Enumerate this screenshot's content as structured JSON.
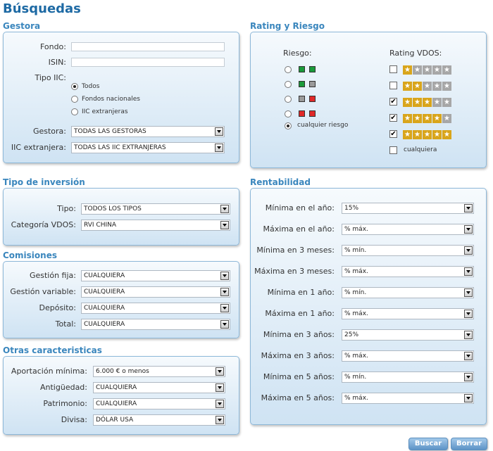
{
  "page": {
    "title": "Búsquedas"
  },
  "gestora": {
    "section_title": "Gestora",
    "fondo_label": "Fondo:",
    "fondo_value": "",
    "isin_label": "ISIN:",
    "isin_value": "",
    "tipo_iic_label": "Tipo IIC:",
    "tipo_iic_options": [
      "Todos",
      "Fondos nacionales",
      "IIC extranjeras"
    ],
    "tipo_iic_selected": "Todos",
    "gestora_label": "Gestora:",
    "gestora_value": "TODAS LAS GESTORAS",
    "iic_ext_label": "IIC extranjera:",
    "iic_ext_value": "TODAS LAS IIC EXTRANJERAS"
  },
  "rating": {
    "section_title": "Rating y Riesgo",
    "riesgo_label": "Riesgo:",
    "rating_label": "Rating VDOS:",
    "riesgo_options": [
      {
        "colors": [
          "#1a9a3a",
          "#1a9a3a"
        ]
      },
      {
        "colors": [
          "#1a9a3a",
          "#9a9a9a"
        ]
      },
      {
        "colors": [
          "#9a9a9a",
          "#e02828"
        ]
      },
      {
        "colors": [
          "#e02828",
          "#e02828"
        ]
      }
    ],
    "riesgo_any_label": "cualquier riesgo",
    "riesgo_selected": "cualquier riesgo",
    "rating_options": [
      {
        "stars": 1,
        "checked": false
      },
      {
        "stars": 2,
        "checked": false
      },
      {
        "stars": 3,
        "checked": true
      },
      {
        "stars": 4,
        "checked": true
      },
      {
        "stars": 5,
        "checked": true
      }
    ],
    "rating_any_label": "cualquiera",
    "rating_any_checked": false,
    "star_on_color": "#d9a51b",
    "star_off_color": "#a7a7a7"
  },
  "tipo_inversion": {
    "section_title": "Tipo de inversión",
    "tipo_label": "Tipo:",
    "tipo_value": "TODOS LOS TIPOS",
    "categoria_label": "Categoría VDOS:",
    "categoria_value": "RVI CHINA"
  },
  "comisiones": {
    "section_title": "Comisiones",
    "rows": [
      {
        "label": "Gestión fija:",
        "value": "CUALQUIERA"
      },
      {
        "label": "Gestión variable:",
        "value": "CUALQUIERA"
      },
      {
        "label": "Depósito:",
        "value": "CUALQUIERA"
      },
      {
        "label": "Total:",
        "value": "CUALQUIERA"
      }
    ]
  },
  "otras": {
    "section_title": "Otras caracteristicas",
    "rows": [
      {
        "label": "Aportación mínima:",
        "value": "6.000 € o menos"
      },
      {
        "label": "Antigüedad:",
        "value": "CUALQUIERA"
      },
      {
        "label": "Patrimonio:",
        "value": "CUALQUIERA"
      },
      {
        "label": "Divisa:",
        "value": "DÓLAR USA"
      }
    ]
  },
  "rentabilidad": {
    "section_title": "Rentabilidad",
    "rows": [
      {
        "label": "Mínima en el año:",
        "value": "15%"
      },
      {
        "label": "Máxima en el año:",
        "value": "% máx."
      },
      {
        "label": "Mínima en 3 meses:",
        "value": "% mín."
      },
      {
        "label": "Máxima en 3 meses:",
        "value": "% máx."
      },
      {
        "label": "Mínima en 1 año:",
        "value": "% mín."
      },
      {
        "label": "Máxima en 1 año:",
        "value": "% máx."
      },
      {
        "label": "Mínima en 3 años:",
        "value": "25%"
      },
      {
        "label": "Máxima en 3 años:",
        "value": "% máx."
      },
      {
        "label": "Mínima en 5 años:",
        "value": "% mín."
      },
      {
        "label": "Máxima en 5 años:",
        "value": "% máx."
      }
    ]
  },
  "actions": {
    "buscar_label": "Buscar",
    "borrar_label": "Borrar"
  }
}
